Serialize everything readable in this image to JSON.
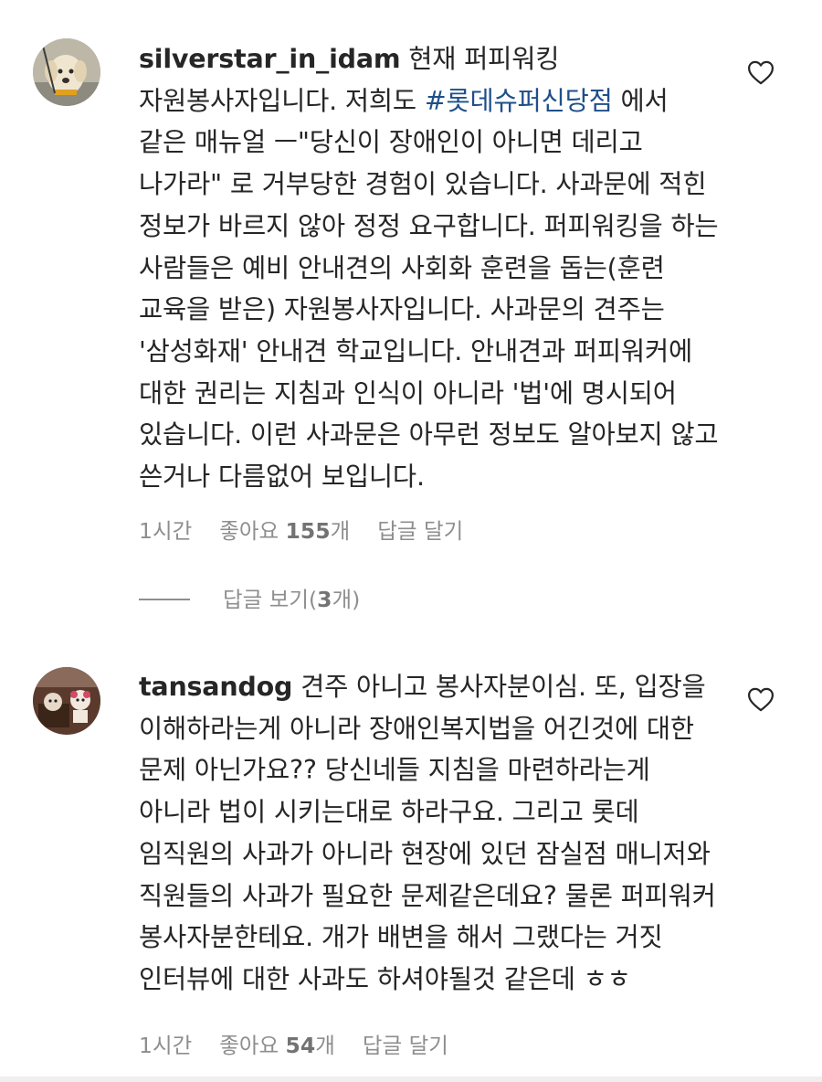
{
  "comments": [
    {
      "username": "silverstar_in_idam",
      "text_before_tag": " 현재 퍼피워킹 자원봉사자입니다. 저희도 ",
      "hashtag": "#롯데슈퍼신당점",
      "text_after_tag": " 에서 같은 매뉴얼 ㅡ\"당신이 장애인이 아니면 데리고 나가라\" 로 거부당한 경험이 있습니다. 사과문에 적힌 정보가 바르지 않아 정정 요구합니다. 퍼피워킹을 하는 사람들은 예비 안내견의 사회화 훈련을 돕는(훈련 교육을 받은) 자원봉사자입니다. 사과문의 견주는 '삼성화재' 안내견 학교입니다. 안내견과 퍼피워커에 대한 권리는 지침과 인식이 아니라 '법'에 명시되어 있습니다. 이런 사과문은 아무런 정보도 알아보지 않고 쓴거나 다름없어 보입니다.",
      "time": "1시간",
      "likes_prefix": "좋아요 ",
      "likes_count": "155",
      "likes_suffix": "개",
      "reply_label": "답글 달기",
      "view_replies_prefix": "답글 보기(",
      "view_replies_count": "3",
      "view_replies_suffix": "개)",
      "like_icon": "heart-outline-icon"
    },
    {
      "username": "tansandog",
      "text": " 견주 아니고 봉사자분이심. 또, 입장을 이해하라는게 아니라 장애인복지법을 어긴것에 대한 문제 아닌가요?? 당신네들 지침을 마련하라는게 아니라 법이 시키는대로 하라구요. 그리고 롯데 임직원의 사과가 아니라 현장에 있던 잠실점 매니저와 직원들의 사과가 필요한 문제같은데요? 물론 퍼피워커 봉사자분한테요. 개가 배변을 해서 그랬다는 거짓 인터뷰에 대한 사과도 하셔야될것 같은데 ㅎㅎ",
      "time": "1시간",
      "likes_prefix": "좋아요 ",
      "likes_count": "54",
      "likes_suffix": "개",
      "reply_label": "답글 달기",
      "like_icon": "heart-outline-icon"
    }
  ]
}
